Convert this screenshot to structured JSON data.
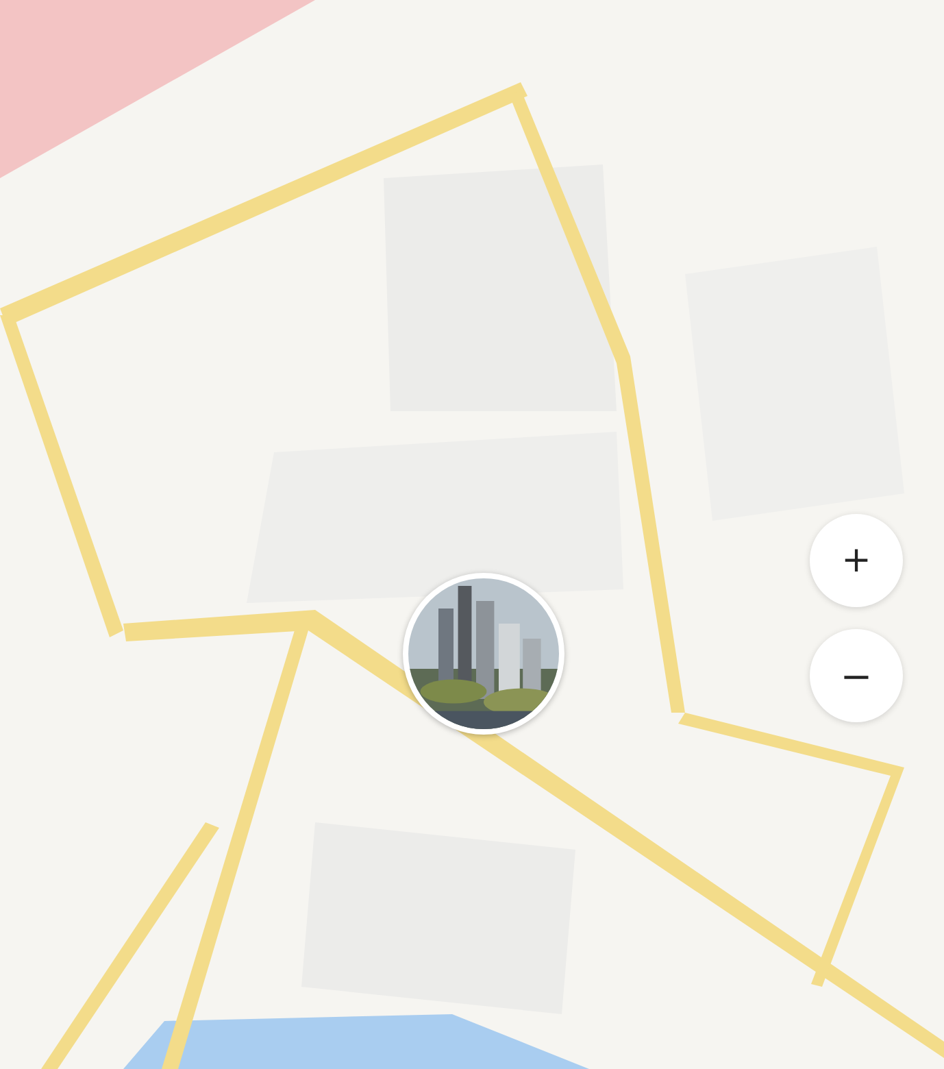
{
  "zoom_controls": [
    {
      "kind": "zoom_in",
      "label": "+"
    },
    {
      "kind": "zoom_out",
      "label": "−"
    }
  ]
}
